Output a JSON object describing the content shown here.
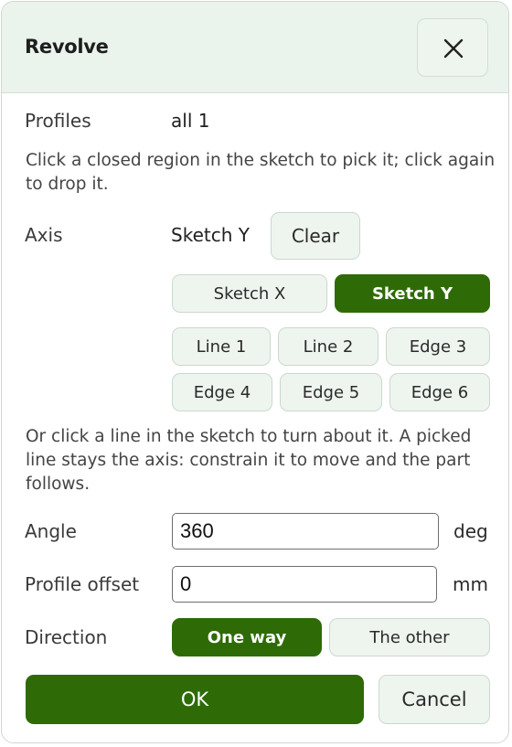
{
  "dialog": {
    "title": "Revolve",
    "close_icon": "close-icon"
  },
  "profiles": {
    "label": "Profiles",
    "value": "all 1",
    "help": "Click a closed region in the sketch to pick it; click again to drop it."
  },
  "axis": {
    "label": "Axis",
    "value": "Sketch Y",
    "clear_label": "Clear",
    "options": [
      {
        "label": "Sketch X",
        "selected": false
      },
      {
        "label": "Sketch Y",
        "selected": true
      },
      {
        "label": "Line 1",
        "selected": false
      },
      {
        "label": "Line 2",
        "selected": false
      },
      {
        "label": "Edge 3",
        "selected": false
      },
      {
        "label": "Edge 4",
        "selected": false
      },
      {
        "label": "Edge 5",
        "selected": false
      },
      {
        "label": "Edge 6",
        "selected": false
      }
    ],
    "help": "Or click a line in the sketch to turn about it. A picked line stays the axis: constrain it to move and the part follows."
  },
  "angle": {
    "label": "Angle",
    "value": "360",
    "unit": "deg"
  },
  "profile_offset": {
    "label": "Profile offset",
    "value": "0",
    "unit": "mm"
  },
  "direction": {
    "label": "Direction",
    "options": [
      {
        "label": "One way",
        "selected": true
      },
      {
        "label": "The other",
        "selected": false
      }
    ]
  },
  "actions": {
    "ok_label": "OK",
    "cancel_label": "Cancel"
  },
  "colors": {
    "accent": "#2e6b06",
    "header_bg": "#eaf3ec",
    "button_bg": "#eef5ef"
  }
}
